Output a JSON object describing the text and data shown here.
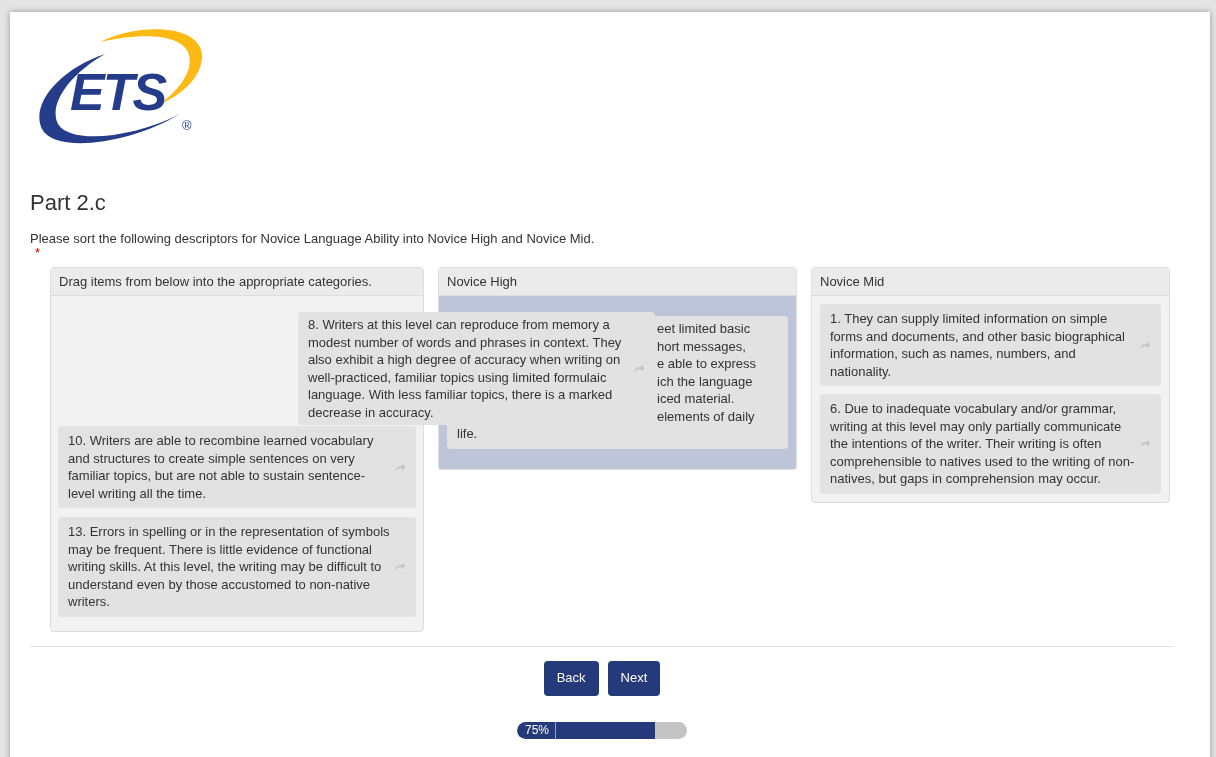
{
  "logo": {
    "text": "ETS",
    "mark": "®"
  },
  "title": "Part 2.c",
  "instruction": "Please sort the following descriptors for Novice Language Ability into Novice High and Novice Mid.",
  "required_mark": "*",
  "source": {
    "header": "Drag items from below into the appropriate categories.",
    "dragging": {
      "text": "8. Writers at this level can reproduce from memory a modest number of words and phrases in context. They also exhibit a high degree of accuracy when writing on well-practiced, familiar topics using limited formulaic language. With less familiar topics, there is a marked decrease in accuracy."
    },
    "items": [
      {
        "text": "10. Writers are able to recombine learned vocabulary and structures to create simple sentences on very familiar topics, but are not able to sustain sentence-level writing all the time."
      },
      {
        "text": "13. Errors in spelling or in the representation of symbols may be frequent. There is little evidence of functional writing skills. At this level, the writing may be difficult to understand even by those accustomed to non-native writers."
      }
    ]
  },
  "categories": [
    {
      "header": "Novice High",
      "drop_target": true,
      "items": [
        {
          "visible_lines": [
            "eet limited basic",
            "hort messages,",
            "e able to express",
            "ich the language",
            "iced material.",
            "elements of daily"
          ],
          "last_line": "life."
        }
      ]
    },
    {
      "header": "Novice Mid",
      "drop_target": false,
      "items": [
        {
          "text": "1. They can supply limited information on simple forms and documents, and other basic biographical information, such as names, numbers, and nationality."
        },
        {
          "text": "6. Due to inadequate vocabulary and/or grammar, writing at this level may only partially communicate the intentions of the writer. Their writing is often comprehensible to natives used to the writing of non-natives, but gaps in comprehension may occur."
        }
      ]
    }
  ],
  "buttons": [
    "Back",
    "Next"
  ],
  "progress": {
    "label": "75%",
    "level": 0.81
  }
}
